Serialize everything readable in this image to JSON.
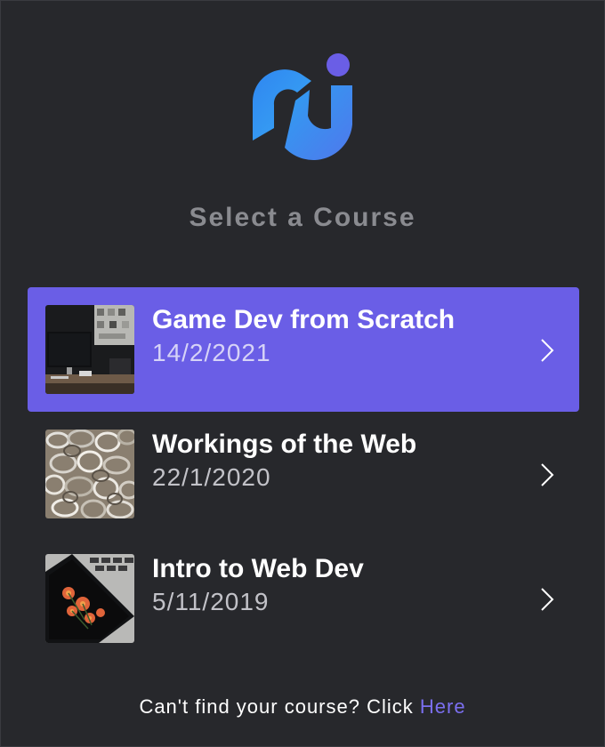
{
  "header": {
    "logo_icon": "app-logo-icon",
    "title": "Select a Course"
  },
  "colors": {
    "background": "#27282c",
    "accent": "#6a5ee6",
    "title_text": "#8a8b90",
    "footer_text": "#ffffff",
    "link": "#7b6ff0"
  },
  "courses": [
    {
      "name": "Game Dev from Scratch",
      "date": "14/2/2021",
      "selected": true,
      "thumbnail": "desk-monitor-photo"
    },
    {
      "name": "Workings of the Web",
      "date": "22/1/2020",
      "selected": false,
      "thumbnail": "metal-rings-photo"
    },
    {
      "name": "Intro to Web Dev",
      "date": "5/11/2019",
      "selected": false,
      "thumbnail": "phone-flowers-photo"
    }
  ],
  "footer": {
    "prompt": "Can't find your course? Click ",
    "link_label": "Here"
  }
}
